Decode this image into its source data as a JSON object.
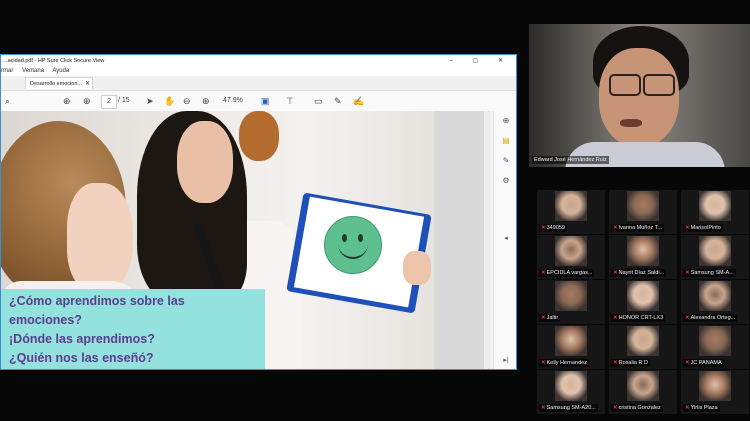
{
  "pdf_window": {
    "title": "...acidad.pdf - HP Sure Click Secure View",
    "menu": [
      "rmar",
      "Ventana",
      "Ayuda"
    ],
    "tab_label": "Desarrollo emocion...",
    "page_current": "2",
    "page_total": "/ 15",
    "zoom": "47.9%"
  },
  "slide": {
    "questions": [
      "¿Cómo aprendimos sobre las",
      "emociones?",
      "¡Dónde las aprendimos?",
      "¿Quién nos las enseñó?"
    ],
    "colors": {
      "box": "#93e2de",
      "text": "#5a3d8e",
      "clipboard": "#1f4fb8",
      "smiley": "#5fc08f"
    }
  },
  "speaker": {
    "name": "Edward José Hernández Ruiz"
  },
  "participants": [
    "349059",
    "Ivanna Muñoz T...",
    "MarisolPinto",
    "EPCIDLA vargas...",
    "Nayrit Díaz Saldi...",
    "Samsung SM-A...",
    "Jaltir",
    "HONOR CRT-LX3",
    "Alexandra Orteg...",
    "Keily Hernandez",
    "Rosalia R D",
    "JC PANAMA",
    "Samsung SM-A20...",
    "cristina Gonzalez",
    "Yirlis Plaza"
  ]
}
